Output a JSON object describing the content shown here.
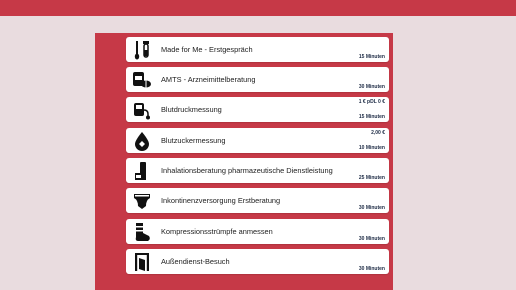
{
  "services": [
    {
      "icon": "swab-tube-icon",
      "label": "Made for Me - Erstgespräch",
      "price": "",
      "duration": "15 Minuten"
    },
    {
      "icon": "pills-icon",
      "label": "AMTS - Arzneimittelberatung",
      "price": "",
      "duration": "30 Minuten"
    },
    {
      "icon": "blood-pressure-icon",
      "label": "Blutdruckmessung",
      "price": "1 € pDL 0 €",
      "duration": "15 Minuten"
    },
    {
      "icon": "blood-drop-icon",
      "label": "Blutzuckermessung",
      "price": "2,00 €",
      "duration": "10 Minuten"
    },
    {
      "icon": "inhaler-icon",
      "label": "Inhalationsberatung pharmazeutische Dienstleistung",
      "price": "",
      "duration": "25 Minuten"
    },
    {
      "icon": "diaper-icon",
      "label": "Inkontinenzversorgung Erstberatung",
      "price": "",
      "duration": "30 Minuten"
    },
    {
      "icon": "compression-sock-icon",
      "label": "Kompressionsstrümpfe anmessen",
      "price": "",
      "duration": "30 Minuten"
    },
    {
      "icon": "door-icon",
      "label": "Außendienst-Besuch",
      "price": "",
      "duration": "30 Minuten"
    }
  ],
  "colors": {
    "brand": "#c63947",
    "background": "#e9dcdf",
    "card": "#ffffff",
    "meta_text": "#1c2a44"
  }
}
